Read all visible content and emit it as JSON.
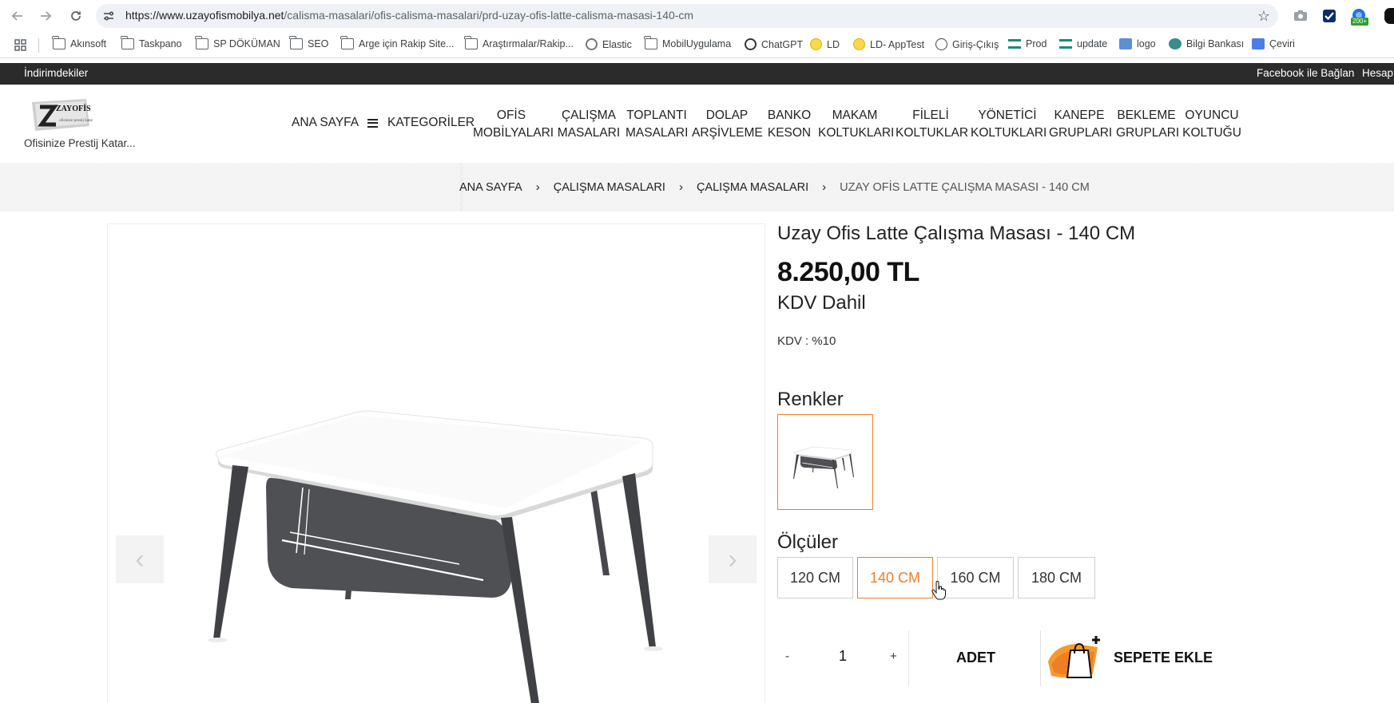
{
  "browser": {
    "url_domain": "https://www.uzayofismobilya.net",
    "url_path": "/calisma-masalari/ofis-calisma-masalari/prd-uzay-ofis-latte-calisma-masasi-140-cm",
    "extension_badge": "200+",
    "bookmarks": [
      {
        "label": "Akınsoft",
        "icon": "folder-icon"
      },
      {
        "label": "Taskpano",
        "icon": "folder-icon"
      },
      {
        "label": "SP DÖKÜMAN",
        "icon": "folder-icon"
      },
      {
        "label": "SEO",
        "icon": "folder-icon"
      },
      {
        "label": "Arge için Rakip Site...",
        "icon": "folder-icon"
      },
      {
        "label": "Araştırmalar/Rakip...",
        "icon": "folder-icon"
      },
      {
        "label": "Elastic",
        "icon": "elastic-icon"
      },
      {
        "label": "MobilUygulama",
        "icon": "folder-icon"
      },
      {
        "label": "ChatGPT",
        "icon": "chatgpt-icon"
      },
      {
        "label": "LD",
        "icon": "yellow-dot-icon"
      },
      {
        "label": "LD- AppTest",
        "icon": "yellow-dot-icon"
      },
      {
        "label": "Giriş-Çıkış",
        "icon": "globe-icon"
      },
      {
        "label": "Prod",
        "icon": "stack-icon"
      },
      {
        "label": "update",
        "icon": "stack-icon"
      },
      {
        "label": "logo",
        "icon": "image-icon"
      },
      {
        "label": "Bilgi Bankası",
        "icon": "people-icon"
      },
      {
        "label": "Çeviri",
        "icon": "translate-icon"
      }
    ]
  },
  "topbar": {
    "left": "İndirimdekiler",
    "facebook": "Facebook ile Bağlan",
    "account": "Hesap"
  },
  "header": {
    "tagline": "Ofisinize Prestij Katar...",
    "home": "ANA SAYFA",
    "categories": "KATEGORİLER",
    "nav": [
      {
        "l1": "OFİS",
        "l2": "MOBİLYALARI"
      },
      {
        "l1": "ÇALIŞMA",
        "l2": "MASALARI"
      },
      {
        "l1": "TOPLANTI",
        "l2": "MASALARI"
      },
      {
        "l1": "DOLAP",
        "l2": "ARŞİVLEME"
      },
      {
        "l1": "BANKO",
        "l2": "KESON"
      },
      {
        "l1": "MAKAM",
        "l2": "KOLTUKLARI"
      },
      {
        "l1": "FİLELİ",
        "l2": "KOLTUKLAR"
      },
      {
        "l1": "YÖNETİCİ",
        "l2": "KOLTUKLARI"
      },
      {
        "l1": "KANEPE",
        "l2": "GRUPLARI"
      },
      {
        "l1": "BEKLEME",
        "l2": "GRUPLARI"
      },
      {
        "l1": "OYUNCU",
        "l2": "KOLTUĞU"
      }
    ]
  },
  "breadcrumb": [
    "ANA SAYFA",
    "ÇALIŞMA MASALARI",
    "ÇALIŞMA MASALARI",
    "UZAY OFİS LATTE ÇALIŞMA MASASI - 140 CM"
  ],
  "product": {
    "title": "Uzay Ofis Latte Çalışma Masası - 140 CM",
    "price": "8.250,00 TL",
    "vat_included": "KDV Dahil",
    "vat_rate": "KDV : %10",
    "colors_label": "Renkler",
    "sizes_label": "Ölçüler",
    "sizes": [
      "120 CM",
      "140 CM",
      "160 CM",
      "180 CM"
    ],
    "selected_size": "140 CM",
    "quantity": "1",
    "minus": "-",
    "plus": "+",
    "unit_label": "ADET",
    "add_to_cart": "SEPETE EKLE"
  },
  "colors": {
    "accent": "#f07e26",
    "topbar_bg": "#2b2b2b",
    "desk_leg": "#4a4c4f",
    "desk_top": "#ffffff"
  }
}
